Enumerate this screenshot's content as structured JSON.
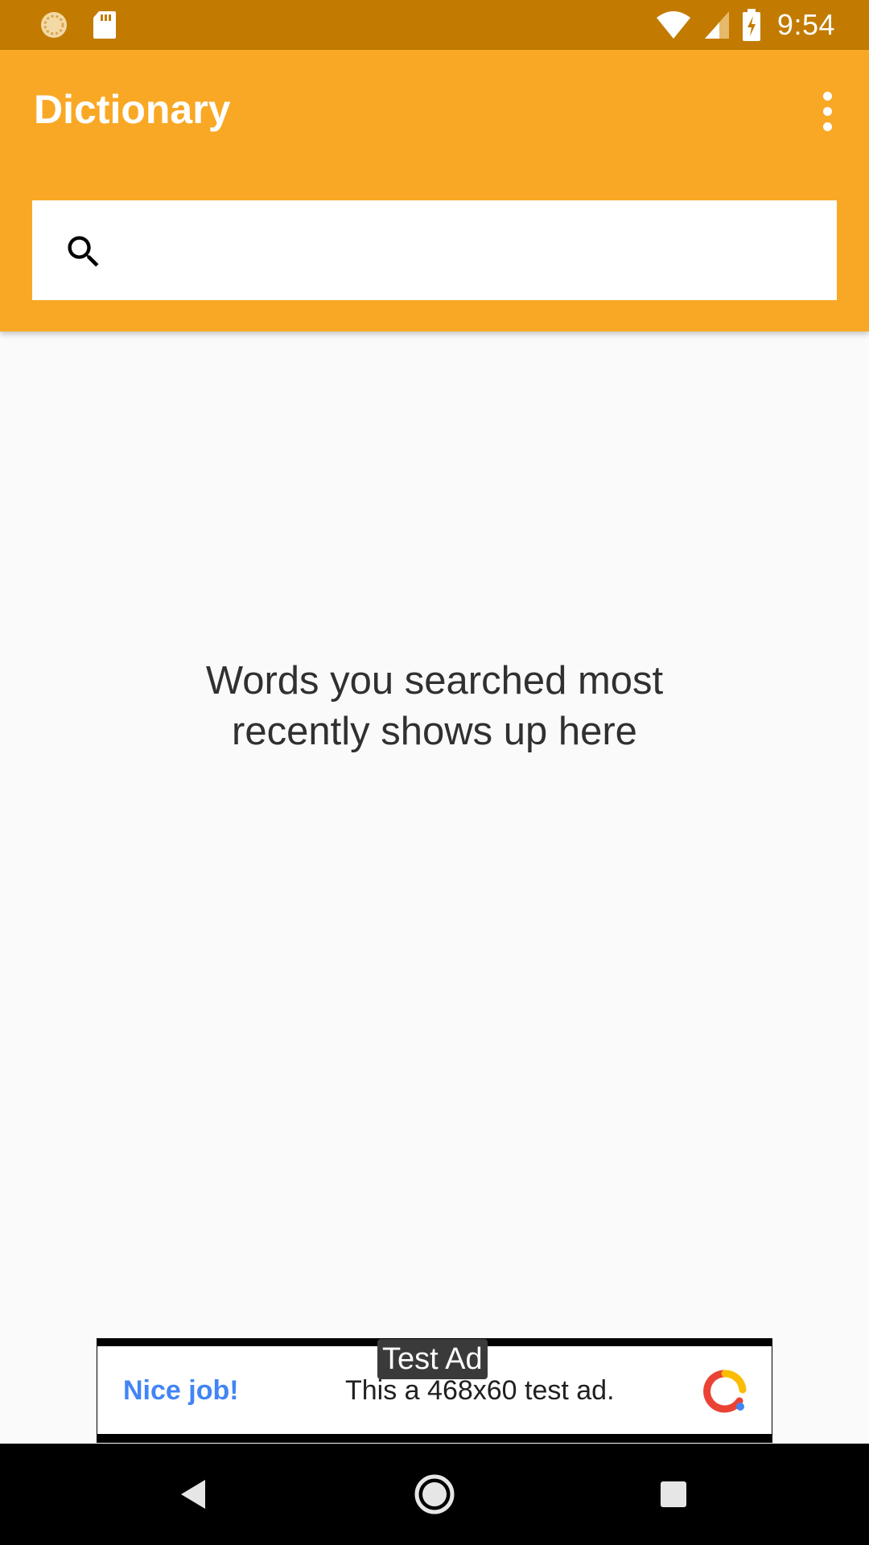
{
  "status_bar": {
    "time": "9:54",
    "icons": [
      "sync-icon",
      "sd-card-icon",
      "wifi-icon",
      "cell-signal-icon",
      "battery-charging-icon"
    ]
  },
  "app_bar": {
    "title": "Dictionary",
    "background_color": "#F9A825",
    "status_color": "#C27B00",
    "search": {
      "value": "",
      "placeholder": ""
    }
  },
  "main": {
    "empty_message_line1": "Words you searched most",
    "empty_message_line2": "recently shows up here"
  },
  "ad": {
    "tag": "Test Ad",
    "headline": "Nice job!",
    "body": "This a 468x60 test ad.",
    "headline_color": "#4285F4"
  },
  "nav_bar": {
    "icons": [
      "back-icon",
      "home-icon",
      "recents-icon"
    ]
  }
}
